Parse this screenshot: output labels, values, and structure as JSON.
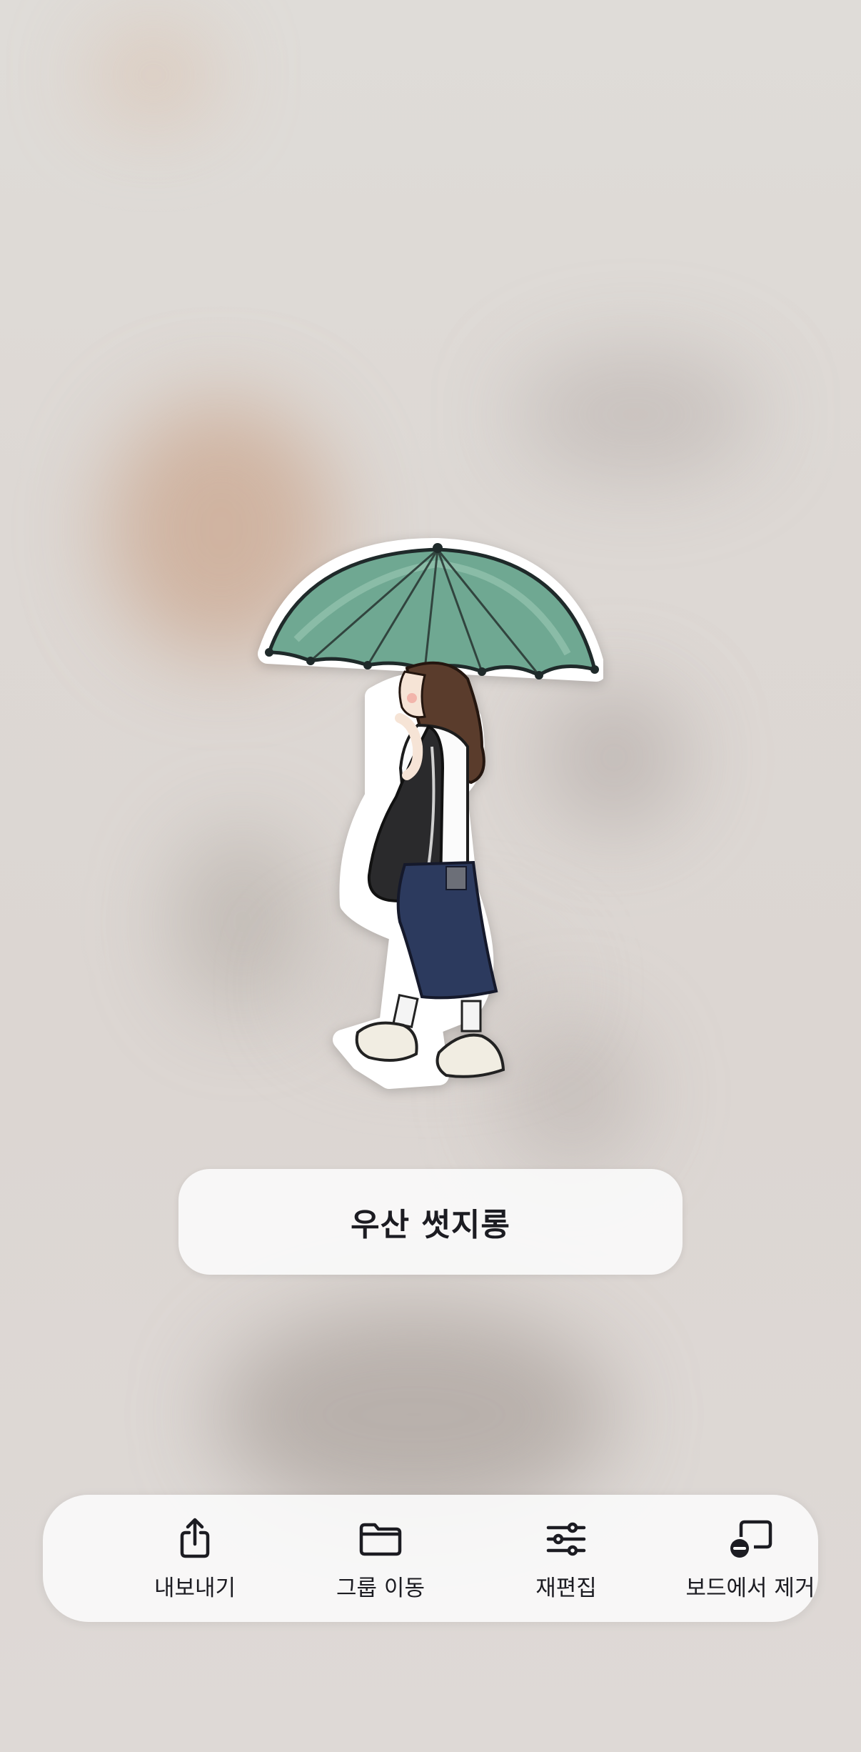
{
  "sticker": {
    "name": "우산 썻지롱"
  },
  "toolbar": {
    "items": [
      {
        "label": "내보내기",
        "icon": "share-icon"
      },
      {
        "label": "그룹 이동",
        "icon": "folder-icon"
      },
      {
        "label": "재편집",
        "icon": "sliders-icon"
      },
      {
        "label": "보드에서 제거",
        "icon": "remove-from-board-icon"
      }
    ]
  },
  "colors": {
    "pill_background": "#fafafa",
    "text": "#1c1c22",
    "umbrella": "#5f9a84",
    "pants": "#2c3a5e"
  }
}
